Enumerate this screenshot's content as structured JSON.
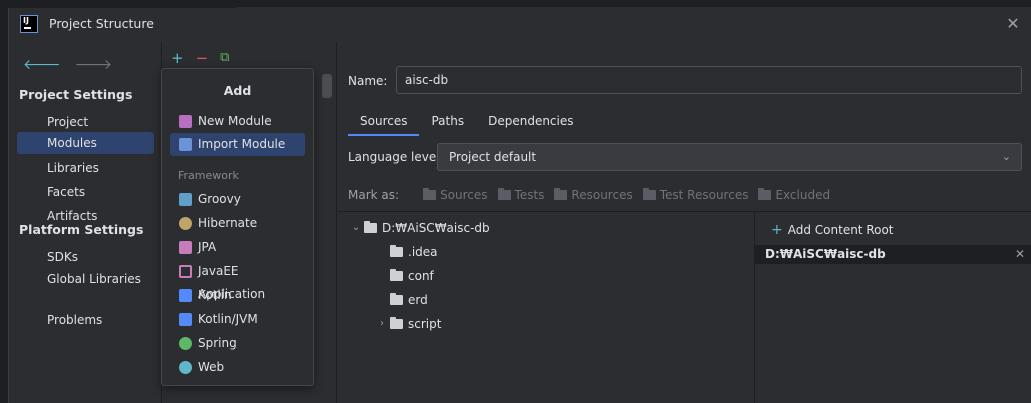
{
  "window": {
    "title": "Project Structure",
    "app_icon_text": "IJ"
  },
  "sidebar": {
    "project_settings_heading": "Project Settings",
    "project_items": [
      "Project",
      "Modules",
      "Libraries",
      "Facets",
      "Artifacts"
    ],
    "selected": "Modules",
    "platform_settings_heading": "Platform Settings",
    "platform_items": [
      "SDKs",
      "Global Libraries"
    ],
    "problems": "Problems"
  },
  "toolbar": {
    "add": "+",
    "remove": "−",
    "copy": "⧉"
  },
  "popup": {
    "title": "Add",
    "items": [
      "New Module",
      "Import Module"
    ],
    "selected": "Import Module",
    "framework_heading": "Framework",
    "frameworks": [
      {
        "label": "Groovy",
        "icon": "groovy-icon",
        "color": "#5f9fc8"
      },
      {
        "label": "Hibernate",
        "icon": "hibernate-icon",
        "color": "#bfa46a"
      },
      {
        "label": "JPA",
        "icon": "jpa-icon",
        "color": "#c77dbb"
      },
      {
        "label": "JavaEE Application",
        "icon": "javaee-icon",
        "color": "#c77dbb"
      },
      {
        "label": "Kotlin",
        "icon": "kotlin-icon",
        "color": "#548af7"
      },
      {
        "label": "Kotlin/JVM",
        "icon": "kotlin-jvm-icon",
        "color": "#548af7"
      },
      {
        "label": "Spring",
        "icon": "spring-icon",
        "color": "#5fb865"
      },
      {
        "label": "Web",
        "icon": "web-icon",
        "color": "#5fb8c9"
      }
    ]
  },
  "main": {
    "name_label": "Name:",
    "name_value": "aisc-db",
    "tabs": [
      "Sources",
      "Paths",
      "Dependencies"
    ],
    "active_tab": "Sources",
    "language_level_label": "Language level:",
    "language_level_value": "Project default",
    "mark_as_label": "Mark as:",
    "mark_as": [
      "Sources",
      "Tests",
      "Resources",
      "Test Resources",
      "Excluded"
    ],
    "tree": [
      {
        "label": "D:₩AiSC₩aisc-db",
        "expanded": true
      },
      {
        "label": ".idea"
      },
      {
        "label": "conf"
      },
      {
        "label": "erd"
      },
      {
        "label": "script",
        "expandable": true
      }
    ],
    "add_content_root": "Add Content Root",
    "content_root": "D:₩AiSC₩aisc-db"
  },
  "colors": {
    "accent": "#548af7",
    "selection": "#2e436e"
  }
}
